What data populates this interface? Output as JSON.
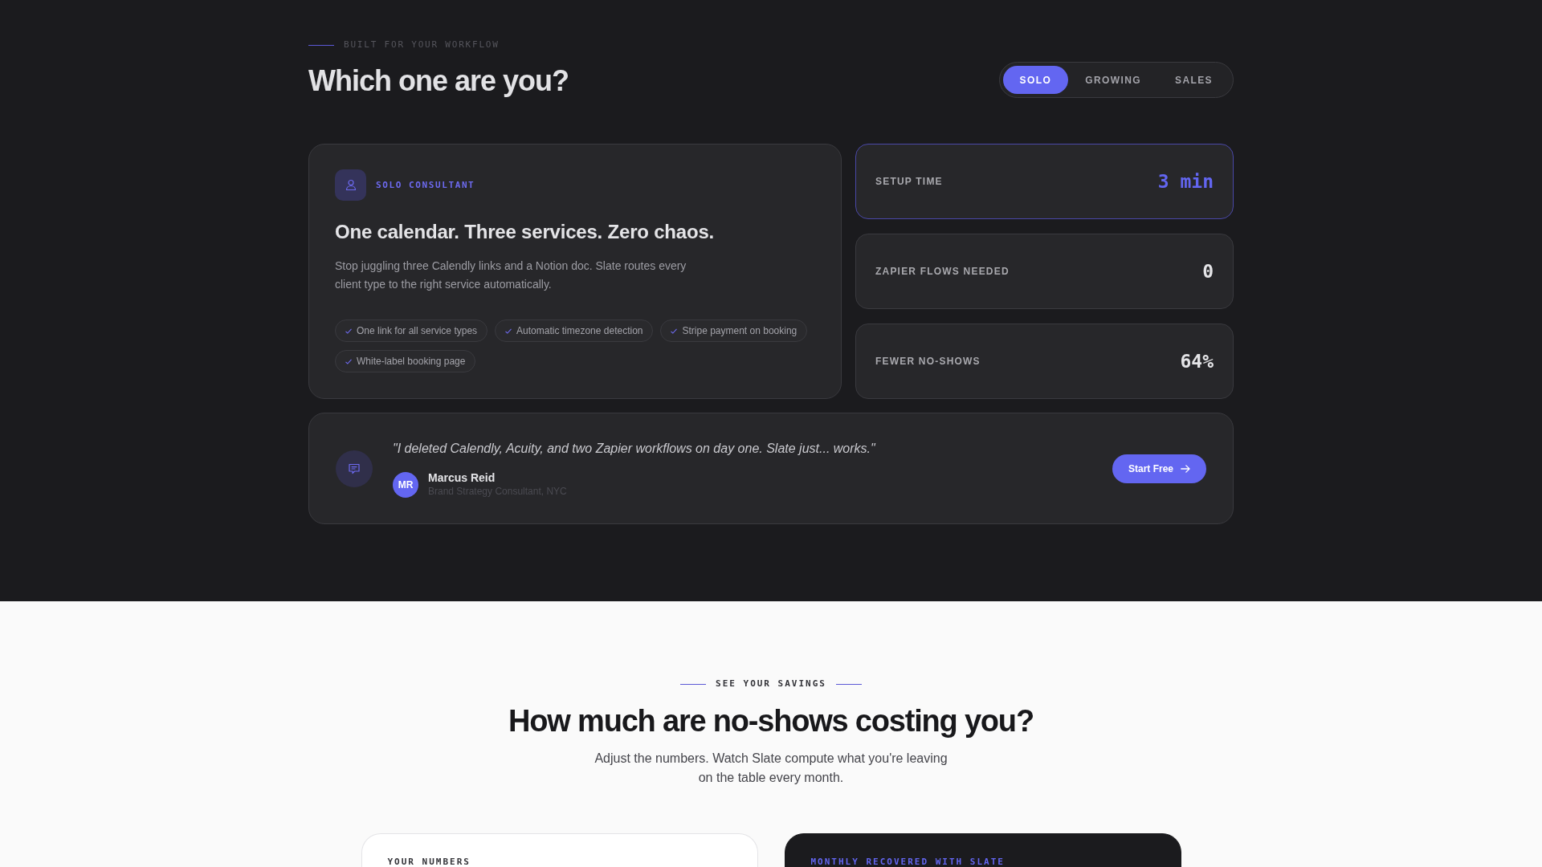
{
  "header": {
    "eyebrow": "BUILT FOR YOUR WORKFLOW",
    "title": "Which one are you?"
  },
  "segments": [
    {
      "label": "SOLO",
      "selected": true
    },
    {
      "label": "GROWING",
      "selected": false
    },
    {
      "label": "SALES",
      "selected": false
    }
  ],
  "persona_card": {
    "badge": "SOLO CONSULTANT",
    "headline": "One calendar. Three services. Zero chaos.",
    "description": "Stop juggling three Calendly links and a Notion doc. Slate routes every client type to the right service automatically.",
    "features": [
      "One link for all service types",
      "Automatic timezone detection",
      "Stripe payment on booking",
      "White-label booking page"
    ]
  },
  "stats": [
    {
      "label": "SETUP TIME",
      "value": "3 min",
      "highlighted": true
    },
    {
      "label": "ZAPIER FLOWS NEEDED",
      "value": "0",
      "highlighted": false
    },
    {
      "label": "FEWER NO-SHOWS",
      "value": "64%",
      "highlighted": false
    }
  ],
  "testimonial": {
    "quote": "\"I deleted Calendly, Acuity, and two Zapier workflows on day one. Slate just... works.\"",
    "initials": "MR",
    "name": "Marcus Reid",
    "role": "Brand Strategy Consultant, NYC",
    "button": "Start Free"
  },
  "savings": {
    "eyebrow": "SEE YOUR SAVINGS",
    "title": "How much are no-shows costing you?",
    "subtitle": "Adjust the numbers. Watch Slate compute what you're leaving on the table every month.",
    "cards": [
      {
        "kind": "light",
        "heading": "YOUR NUMBERS"
      },
      {
        "kind": "dark",
        "heading": "MONTHLY RECOVERED WITH SLATE"
      }
    ]
  }
}
